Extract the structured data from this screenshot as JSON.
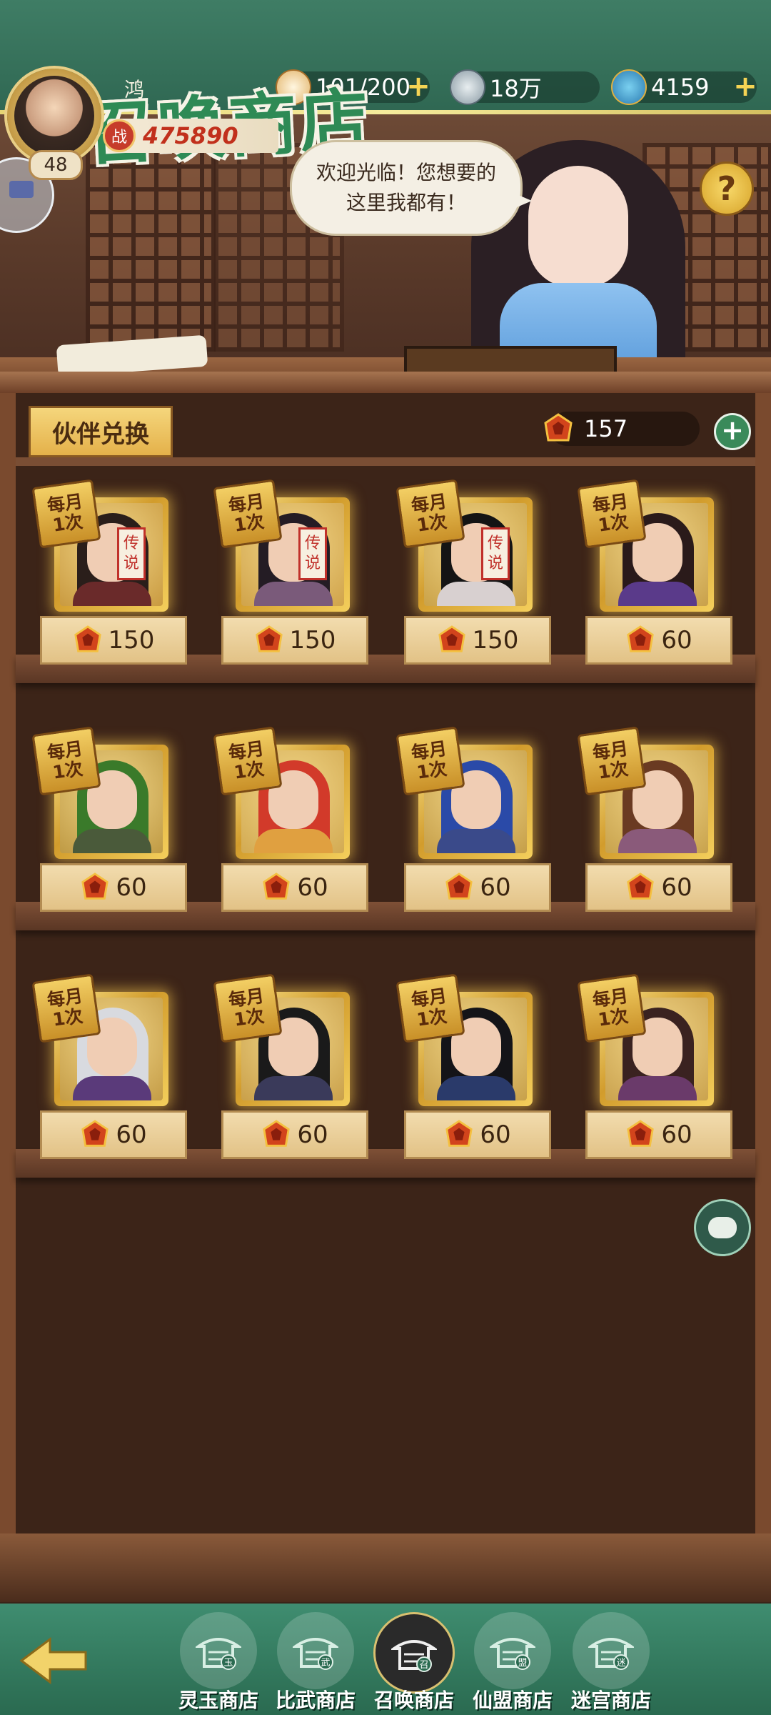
{
  "player": {
    "name": "鸿",
    "level": "48",
    "power": "475890",
    "power_icon_text": "战"
  },
  "resources": [
    {
      "name": "stamina",
      "value": "101/200",
      "has_plus": true
    },
    {
      "name": "coins",
      "value": "18万",
      "has_plus": false
    },
    {
      "name": "jade",
      "value": "4159",
      "has_plus": true
    }
  ],
  "banner": {
    "title": "召唤商店",
    "speech_line1": "欢迎光临！您想要的",
    "speech_line2": "这里我都有！",
    "help": "?"
  },
  "shop": {
    "tab_label": "伙伴兑换",
    "currency_amount": "157",
    "add_symbol": "+"
  },
  "cards": [
    {
      "badge_line1": "每月",
      "badge_line2": "1次",
      "price": "150",
      "legendary": true,
      "legend_l1": "传",
      "legend_l2": "说"
    },
    {
      "badge_line1": "每月",
      "badge_line2": "1次",
      "price": "150",
      "legendary": true,
      "legend_l1": "传",
      "legend_l2": "说"
    },
    {
      "badge_line1": "每月",
      "badge_line2": "1次",
      "price": "150",
      "legendary": true,
      "legend_l1": "传",
      "legend_l2": "说"
    },
    {
      "badge_line1": "每月",
      "badge_line2": "1次",
      "price": "60",
      "legendary": false
    },
    {
      "badge_line1": "每月",
      "badge_line2": "1次",
      "price": "60",
      "legendary": false
    },
    {
      "badge_line1": "每月",
      "badge_line2": "1次",
      "price": "60",
      "legendary": false
    },
    {
      "badge_line1": "每月",
      "badge_line2": "1次",
      "price": "60",
      "legendary": false
    },
    {
      "badge_line1": "每月",
      "badge_line2": "1次",
      "price": "60",
      "legendary": false
    },
    {
      "badge_line1": "每月",
      "badge_line2": "1次",
      "price": "60",
      "legendary": false
    },
    {
      "badge_line1": "每月",
      "badge_line2": "1次",
      "price": "60",
      "legendary": false
    },
    {
      "badge_line1": "每月",
      "badge_line2": "1次",
      "price": "60",
      "legendary": false
    },
    {
      "badge_line1": "每月",
      "badge_line2": "1次",
      "price": "60",
      "legendary": false
    }
  ],
  "nav": {
    "items": [
      {
        "label": "灵玉商店",
        "glyph": "玉",
        "active": false
      },
      {
        "label": "比武商店",
        "glyph": "武",
        "active": false
      },
      {
        "label": "召唤商店",
        "glyph": "召",
        "active": true
      },
      {
        "label": "仙盟商店",
        "glyph": "盟",
        "active": false
      },
      {
        "label": "迷宫商店",
        "glyph": "迷",
        "active": false
      }
    ]
  },
  "colors": {
    "accent_green": "#3f8d70",
    "gold": "#f3cf64",
    "price_red": "#c1301c"
  },
  "icons": [
    "steamed-bun-icon",
    "coin-icon",
    "jade-icon",
    "plus-icon",
    "help-icon",
    "gem-currency-icon",
    "chat-icon",
    "back-arrow-icon",
    "pagoda-icon"
  ]
}
